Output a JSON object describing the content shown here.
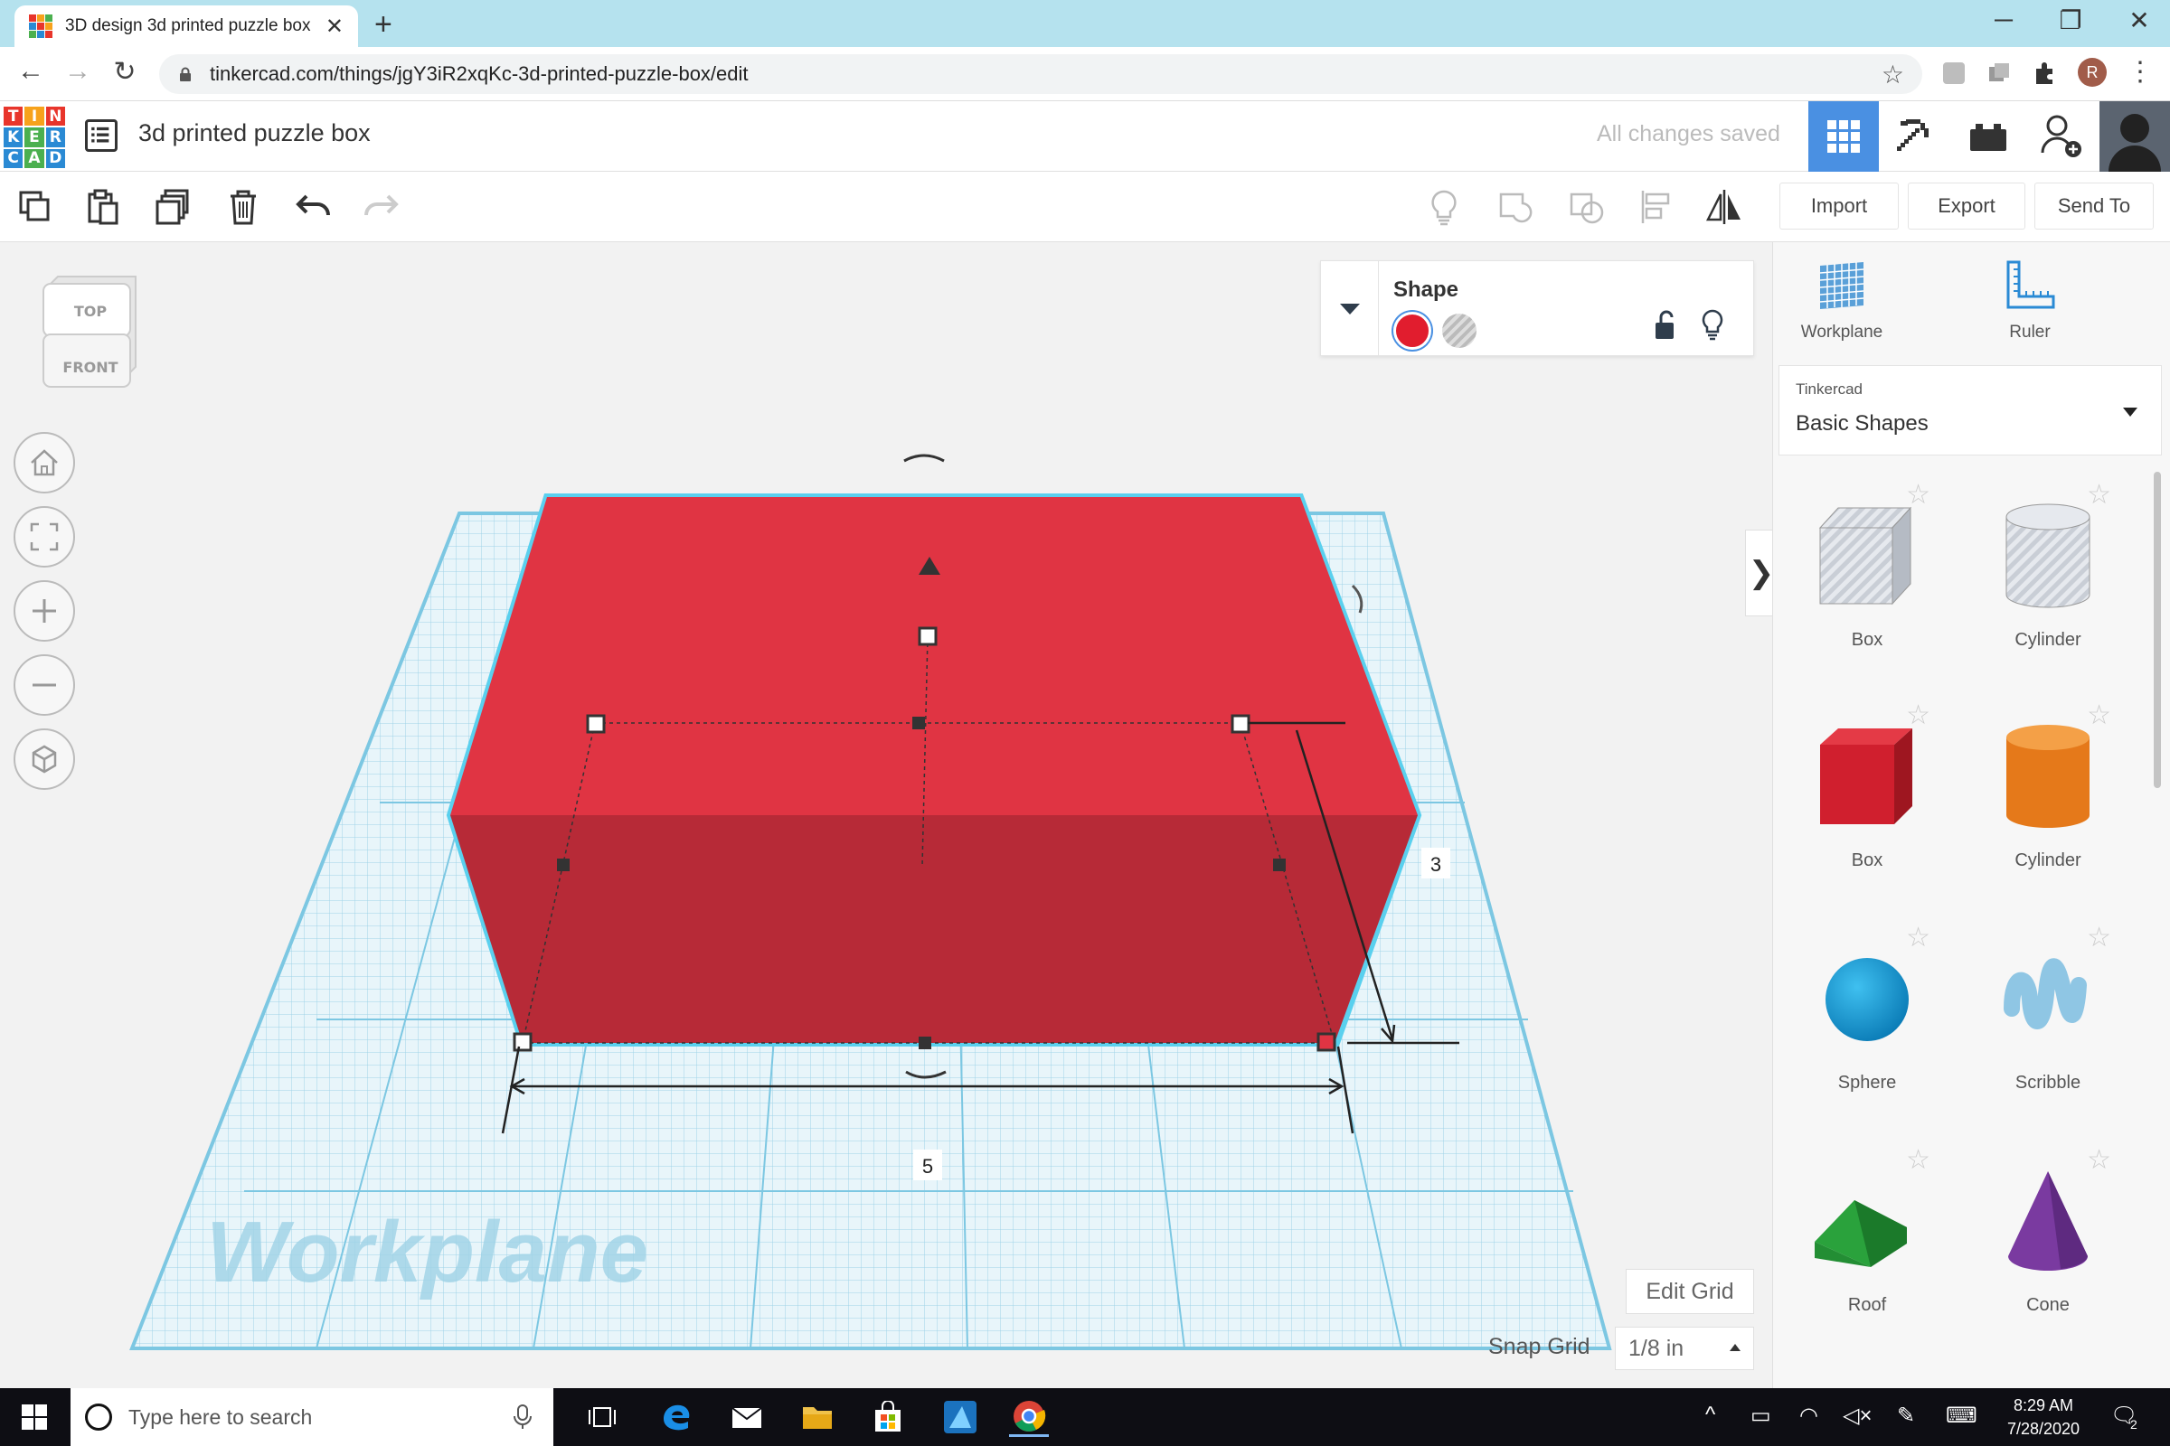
{
  "browser": {
    "tab_title": "3D design 3d printed puzzle box",
    "tab_close": "✕",
    "new_tab": "+",
    "url": "tinkercad.com/things/jgY3iR2xqKc-3d-printed-puzzle-box/edit",
    "profile_initial": "R",
    "window_controls": {
      "minimize": "─",
      "maximize": "❐",
      "close": "✕"
    }
  },
  "header": {
    "logo_letters": [
      "T",
      "I",
      "N",
      "K",
      "E",
      "R",
      "C",
      "A",
      "D"
    ],
    "design_title": "3d printed puzzle box",
    "save_status": "All changes saved",
    "colors": {
      "active_view": "#4a90e2"
    }
  },
  "toolbar": {
    "import_label": "Import",
    "export_label": "Export",
    "sendto_label": "Send To"
  },
  "viewcube": {
    "top": "TOP",
    "front": "FRONT"
  },
  "inspector": {
    "title": "Shape",
    "solid_color": "#e11d2e"
  },
  "workplane": {
    "watermark": "Workplane",
    "dimension_width": "5",
    "dimension_depth": "3",
    "edit_grid_label": "Edit Grid",
    "snap_grid_label": "Snap Grid",
    "snap_grid_value": "1/8 in"
  },
  "right_panel": {
    "workplane_label": "Workplane",
    "ruler_label": "Ruler",
    "library_provider": "Tinkercad",
    "library_name": "Basic Shapes",
    "shapes": [
      {
        "label": "Box",
        "icon": "box-hole-icon"
      },
      {
        "label": "Cylinder",
        "icon": "cylinder-hole-icon"
      },
      {
        "label": "Box",
        "icon": "box-icon"
      },
      {
        "label": "Cylinder",
        "icon": "cylinder-icon"
      },
      {
        "label": "Sphere",
        "icon": "sphere-icon"
      },
      {
        "label": "Scribble",
        "icon": "scribble-icon"
      },
      {
        "label": "Roof",
        "icon": "roof-icon"
      },
      {
        "label": "Cone",
        "icon": "cone-icon"
      }
    ]
  },
  "taskbar": {
    "search_placeholder": "Type here to search",
    "time": "8:29 AM",
    "date": "7/28/2020",
    "notification_count": "2"
  }
}
